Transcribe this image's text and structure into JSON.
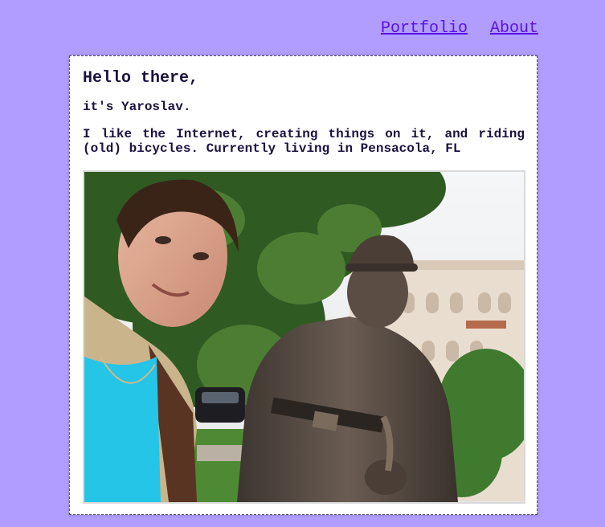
{
  "nav": {
    "items": [
      {
        "label": "Portfolio"
      },
      {
        "label": "About"
      }
    ]
  },
  "card": {
    "title": "Hello there,",
    "subtitle": "it's Yaroslav.",
    "bio": "I like the Internet, creating things on it, and riding (old) bicycles. Currently living in Pensacola, FL"
  },
  "colors": {
    "background": "#b09dff",
    "link": "#5b10e6",
    "text": "#1c1140",
    "card": "#ffffff"
  }
}
